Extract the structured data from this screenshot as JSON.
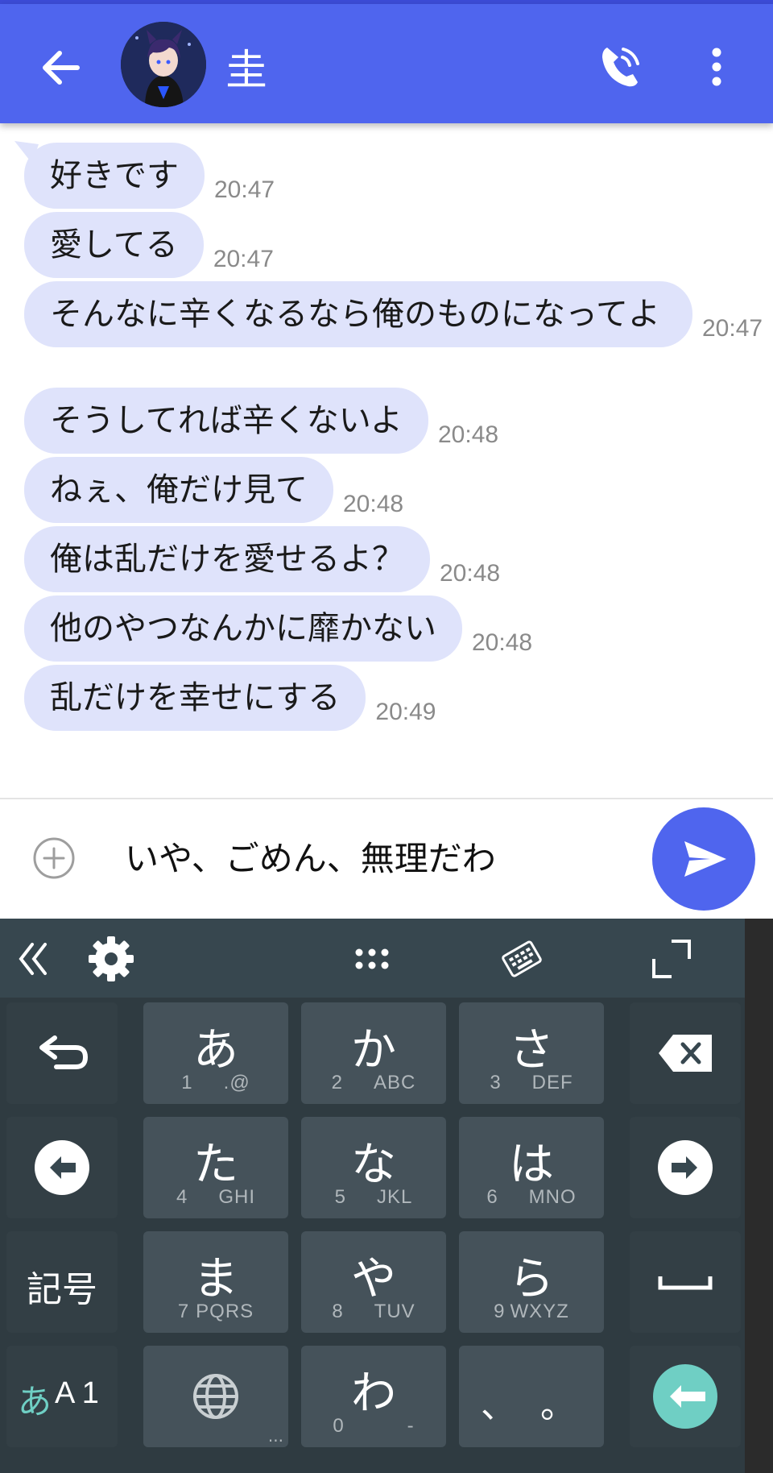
{
  "header": {
    "contact_name": "圭"
  },
  "messages": [
    {
      "text": "好きです",
      "time": "20:47"
    },
    {
      "text": "愛してる",
      "time": "20:47"
    },
    {
      "text": "そんなに辛くなるなら俺のものになってよ",
      "time": "20:47"
    },
    {
      "text": "そうしてれば辛くないよ",
      "time": "20:48"
    },
    {
      "text": "ねぇ、俺だけ見て",
      "time": "20:48"
    },
    {
      "text": "俺は乱だけを愛せるよ？",
      "time": "20:48"
    },
    {
      "text": "他のやつなんかに靡かない",
      "time": "20:48"
    },
    {
      "text": "乱だけを幸せにする",
      "time": "20:49"
    }
  ],
  "composer": {
    "value": "いや、ごめん、無理だわ"
  },
  "keyboard": {
    "keys": [
      {
        "kana": "あ",
        "num": "1",
        "alt": ".@"
      },
      {
        "kana": "か",
        "num": "2",
        "alt": "ABC"
      },
      {
        "kana": "さ",
        "num": "3",
        "alt": "DEF"
      },
      {
        "kana": "た",
        "num": "4",
        "alt": "GHI"
      },
      {
        "kana": "な",
        "num": "5",
        "alt": "JKL"
      },
      {
        "kana": "は",
        "num": "6",
        "alt": "MNO"
      },
      {
        "kana": "ま",
        "num": "7",
        "alt": "PQRS"
      },
      {
        "kana": "や",
        "num": "8",
        "alt": "TUV"
      },
      {
        "kana": "ら",
        "num": "9",
        "alt": "WXYZ"
      },
      {
        "kana": "わ",
        "num": "0",
        "alt": "-"
      }
    ],
    "symbols_label": "記号",
    "mode_kana": "あ",
    "mode_alnum": "A 1",
    "punct": "、 。",
    "ellipsis": "..."
  },
  "colors": {
    "header": "#4f65ee",
    "bubble": "#dfe3fb",
    "keyboard": "#37474f",
    "enter_key": "#6fcfc4"
  }
}
